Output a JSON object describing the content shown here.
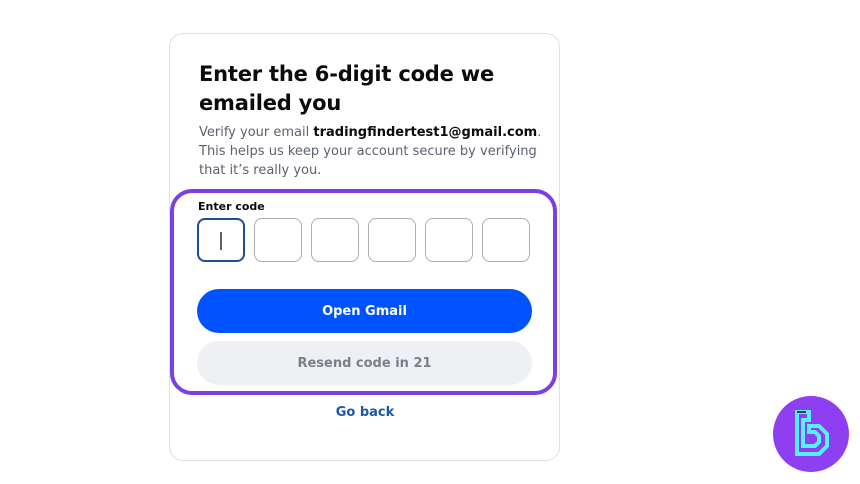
{
  "verify": {
    "title": "Enter the 6-digit code we emailed you",
    "desc_prefix": "Verify your email ",
    "email": "tradingfindertest1@gmail.com",
    "desc_suffix": ". This helps us keep your account secure by verifying that it’s really you.",
    "code_label": "Enter code",
    "code_digits": [
      "",
      "",
      "",
      "",
      "",
      ""
    ],
    "open_gmail_label": "Open Gmail",
    "resend_label": "Resend code in 21",
    "go_back_label": "Go back"
  },
  "colors": {
    "primary": "#0052ff",
    "highlight": "#7b3fe4",
    "link": "#1f57a6",
    "logo_bg": "#8e3ff1",
    "logo_mark": "#56f0ff"
  },
  "icons": {
    "logo": "tradingfinder-logo"
  }
}
